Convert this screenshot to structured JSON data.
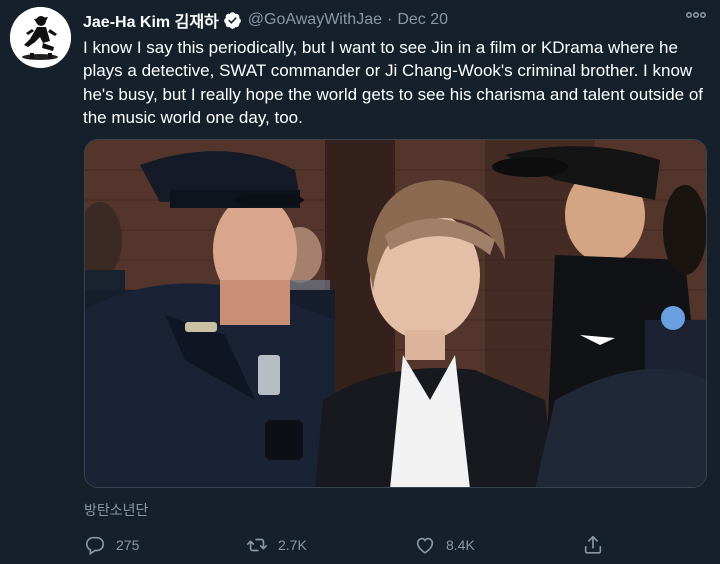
{
  "author": {
    "display_name": "Jae-Ha Kim 김재하",
    "handle": "@GoAwayWithJae",
    "separator": "·",
    "date": "Dec 20",
    "verified": true
  },
  "tweet": {
    "text": "I know I say this periodically, but I want to see Jin in a film or KDrama where he plays a detective, SWAT commander or Ji Chang-Wook's criminal brother. I know he's busy, but I really hope the world gets to see his charisma and talent outside of the music world one day, too."
  },
  "media": {
    "type": "photo"
  },
  "translate_label": "방탄소년단",
  "actions": {
    "reply_count": "275",
    "retweet_count": "2.7K",
    "like_count": "8.4K"
  },
  "icons": {
    "avatar": "avatar",
    "verified": "verified-badge-icon",
    "more": "more-options-icon",
    "reply": "reply-icon",
    "retweet": "retweet-icon",
    "like": "heart-icon",
    "share": "share-icon"
  },
  "colors": {
    "background": "#15202b",
    "text_primary": "#ffffff",
    "text_secondary": "#8899a6",
    "border": "#38444d"
  }
}
